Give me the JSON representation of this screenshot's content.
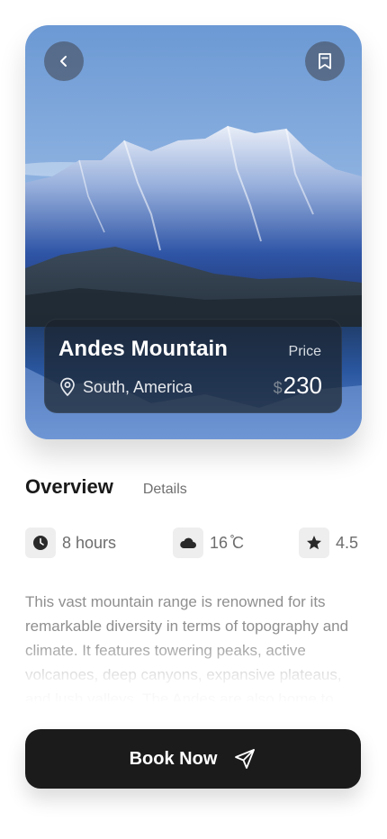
{
  "hero": {
    "place_name": "Andes Mountain",
    "location": "South, America",
    "price_label": "Price",
    "currency": "$",
    "price": "230"
  },
  "tabs": [
    {
      "label": "Overview",
      "active": true
    },
    {
      "label": "Details",
      "active": false
    }
  ],
  "stats": {
    "duration": "8 hours",
    "temperature": "16 ̊C",
    "rating": "4.5"
  },
  "description": "This vast mountain range is renowned for its remarkable diversity in terms of topography and climate. It features towering peaks, active volcanoes, deep canyons, expansive plateaus, and lush valleys. The Andes are also home to",
  "cta": {
    "label": "Book Now"
  },
  "icons": {
    "back": "chevron-left-icon",
    "bookmark": "bookmark-icon",
    "location": "location-pin-icon",
    "duration": "clock-icon",
    "weather": "cloud-icon",
    "rating": "star-icon",
    "send": "send-icon"
  },
  "colors": {
    "primary_button": "#1b1b1b",
    "sky_top": "#6d9bd6",
    "lake": "#234a88"
  }
}
